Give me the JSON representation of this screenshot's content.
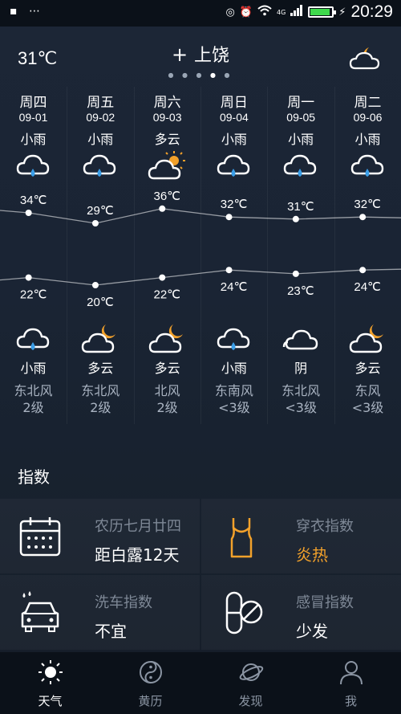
{
  "status_bar": {
    "left_icons": [
      "notification-icon",
      "more-icon"
    ],
    "time": "20:29",
    "network": "4G"
  },
  "header": {
    "current_temp": "31℃",
    "add_symbol": "+",
    "city": "上饶",
    "current_icon": "partly-cloudy-night-icon"
  },
  "forecast": {
    "days": [
      {
        "name": "周四",
        "date": "09-01",
        "day_cond": "小雨",
        "day_icon": "rain-icon",
        "high": "34℃",
        "low": "22℃",
        "night_cond": "小雨",
        "night_icon": "rain-icon",
        "wind_dir": "东北风",
        "wind_level": "2级"
      },
      {
        "name": "周五",
        "date": "09-02",
        "day_cond": "小雨",
        "day_icon": "rain-icon",
        "high": "29℃",
        "low": "20℃",
        "night_cond": "多云",
        "night_icon": "partly-cloudy-night-icon",
        "wind_dir": "东北风",
        "wind_level": "2级"
      },
      {
        "name": "周六",
        "date": "09-03",
        "day_cond": "多云",
        "day_icon": "partly-cloudy-day-icon",
        "high": "36℃",
        "low": "22℃",
        "night_cond": "多云",
        "night_icon": "partly-cloudy-night-icon",
        "wind_dir": "北风",
        "wind_level": "2级"
      },
      {
        "name": "周日",
        "date": "09-04",
        "day_cond": "小雨",
        "day_icon": "rain-icon",
        "high": "32℃",
        "low": "24℃",
        "night_cond": "小雨",
        "night_icon": "rain-icon",
        "wind_dir": "东南风",
        "wind_level": "<3级"
      },
      {
        "name": "周一",
        "date": "09-05",
        "day_cond": "小雨",
        "day_icon": "rain-icon",
        "high": "31℃",
        "low": "23℃",
        "night_cond": "阴",
        "night_icon": "overcast-icon",
        "wind_dir": "东北风",
        "wind_level": "<3级"
      },
      {
        "name": "周二",
        "date": "09-06",
        "day_cond": "小雨",
        "day_icon": "rain-icon",
        "high": "32℃",
        "low": "24℃",
        "night_cond": "多云",
        "night_icon": "partly-cloudy-night-icon",
        "wind_dir": "东风",
        "wind_level": "<3级"
      }
    ]
  },
  "chart_data": {
    "type": "line",
    "categories": [
      "09-01",
      "09-02",
      "09-03",
      "09-04",
      "09-05",
      "09-06"
    ],
    "series": [
      {
        "values": [
          34,
          29,
          36,
          32,
          31,
          32
        ]
      },
      {
        "values": [
          22,
          20,
          22,
          24,
          23,
          24
        ]
      }
    ],
    "unit": "℃"
  },
  "indices": {
    "title": "指数",
    "items": [
      {
        "label": "农历七月廿四",
        "value": "距白露12天",
        "icon": "calendar-icon",
        "accent": false
      },
      {
        "label": "穿衣指数",
        "value": "炎热",
        "icon": "tank-top-icon",
        "accent": true
      },
      {
        "label": "洗车指数",
        "value": "不宜",
        "icon": "car-wash-icon",
        "accent": false
      },
      {
        "label": "感冒指数",
        "value": "少发",
        "icon": "pill-icon",
        "accent": false
      }
    ]
  },
  "tabs": [
    {
      "label": "天气",
      "icon": "sun-icon",
      "active": true
    },
    {
      "label": "黄历",
      "icon": "yin-yang-icon",
      "active": false
    },
    {
      "label": "发现",
      "icon": "planet-icon",
      "active": false
    },
    {
      "label": "我",
      "icon": "person-icon",
      "active": false
    }
  ],
  "colors": {
    "accent": "#f2a12b",
    "background": "#1a2434",
    "tab_bar": "#0b1119",
    "rain_drop": "#3a9ee8"
  }
}
